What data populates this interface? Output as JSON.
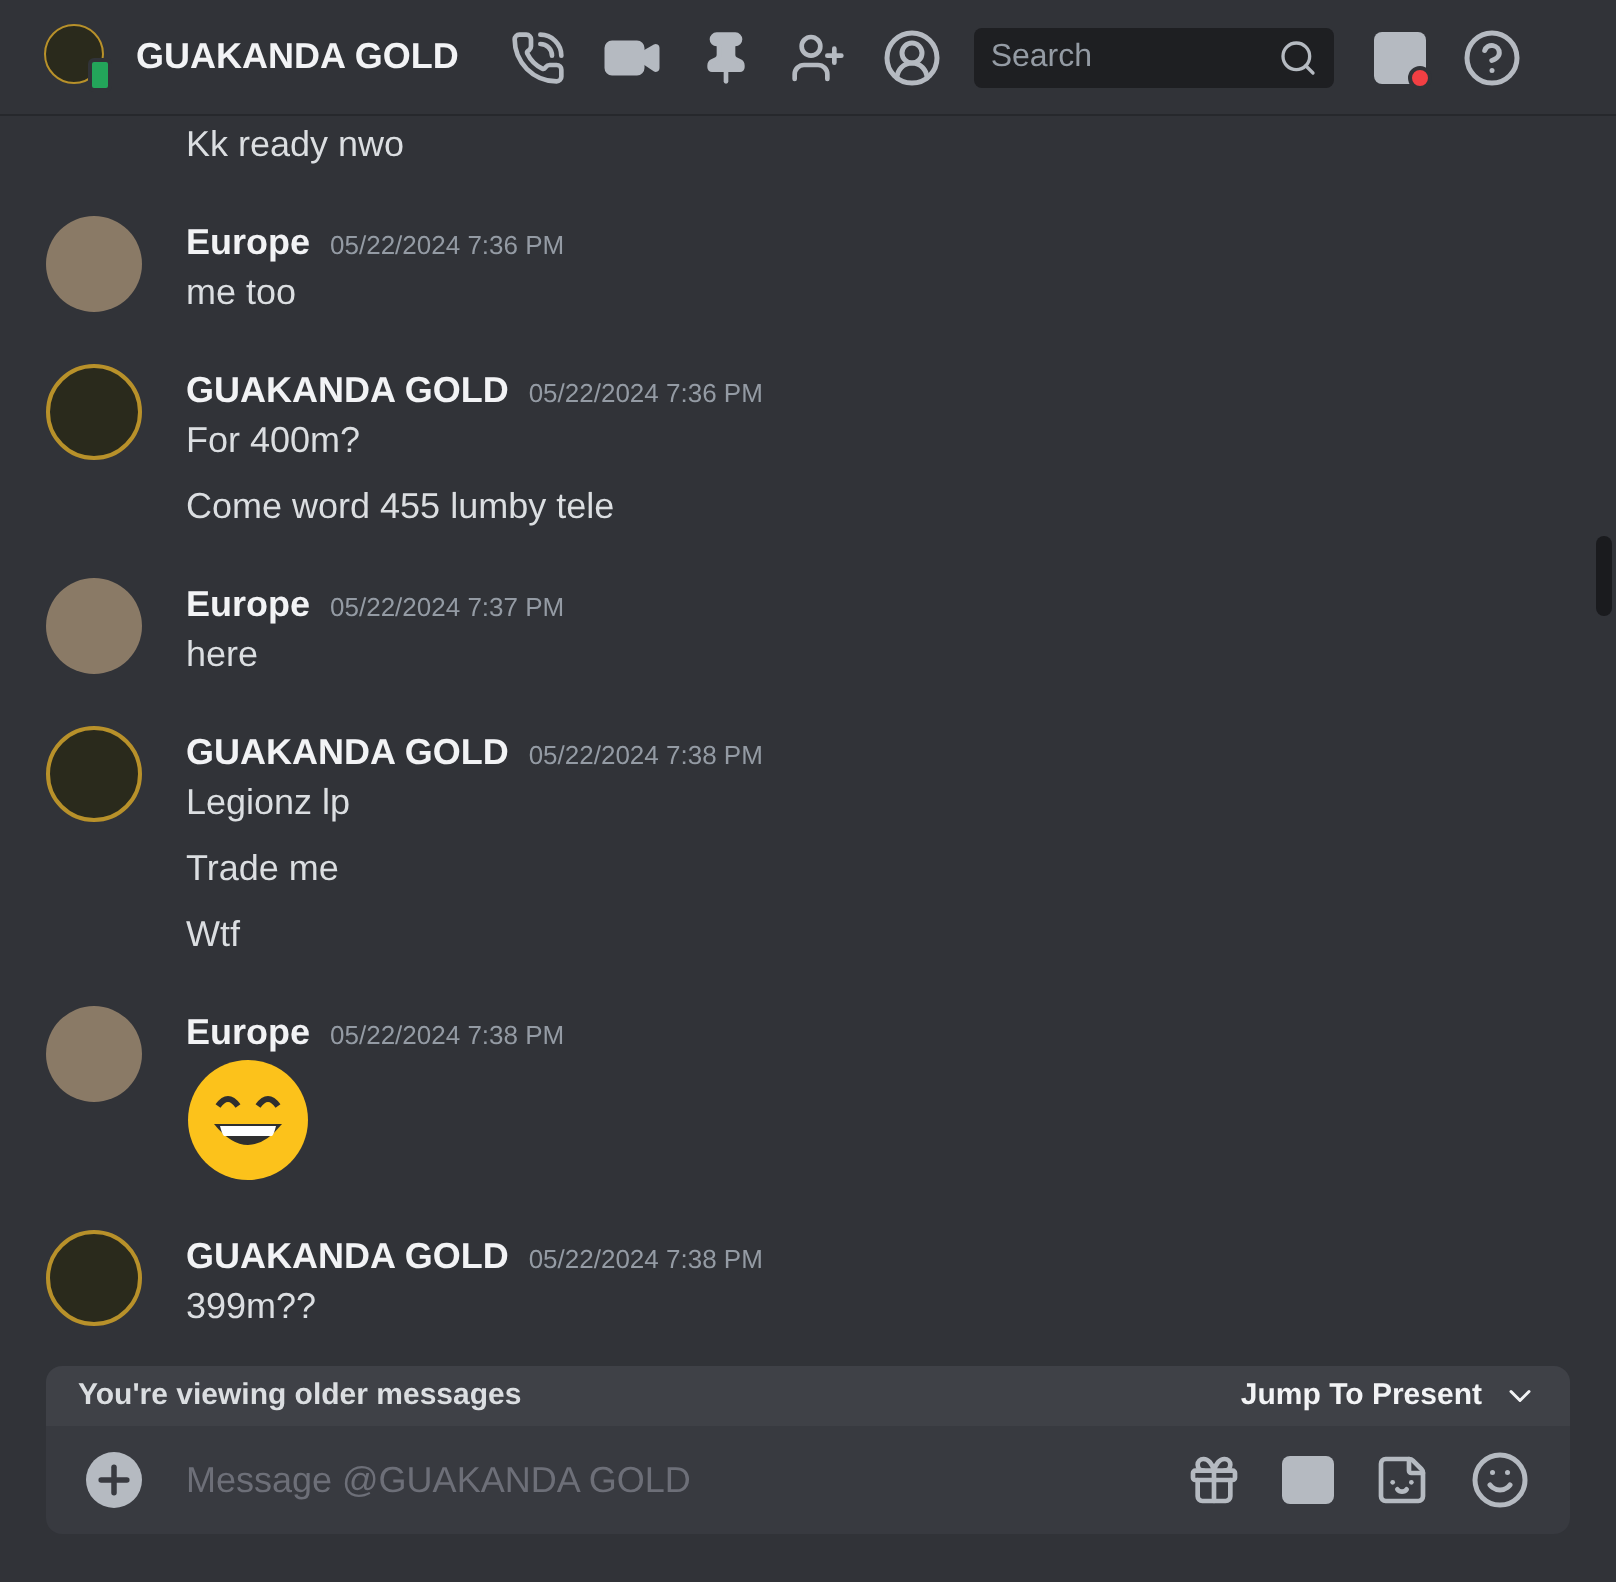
{
  "header": {
    "title": "GUAKANDA GOLD",
    "search": {
      "placeholder": "Search"
    }
  },
  "messages": [
    {
      "kind": "continuation",
      "lines": [
        {
          "kind": "text",
          "text": "Kk ready nwo"
        }
      ]
    },
    {
      "kind": "photo-avatar",
      "author": "Europe",
      "timestamp": "05/22/2024 7:36 PM",
      "lines": [
        {
          "kind": "text",
          "text": "me too"
        }
      ]
    },
    {
      "kind": "logo-avatar",
      "author": "GUAKANDA GOLD",
      "timestamp": "05/22/2024 7:36 PM",
      "lines": [
        {
          "kind": "text",
          "text": "For 400m?"
        },
        {
          "kind": "text",
          "text": "Come word 455 lumby tele"
        }
      ]
    },
    {
      "kind": "photo-avatar",
      "author": "Europe",
      "timestamp": "05/22/2024 7:37 PM",
      "lines": [
        {
          "kind": "text",
          "text": "here"
        }
      ]
    },
    {
      "kind": "logo-avatar",
      "author": "GUAKANDA GOLD",
      "timestamp": "05/22/2024 7:38 PM",
      "lines": [
        {
          "kind": "text",
          "text": "Legionz lp"
        },
        {
          "kind": "text",
          "text": "Trade me"
        },
        {
          "kind": "text",
          "text": "Wtf"
        }
      ]
    },
    {
      "kind": "photo-avatar",
      "author": "Europe",
      "timestamp": "05/22/2024 7:38 PM",
      "lines": [
        {
          "kind": "emoji"
        }
      ]
    },
    {
      "kind": "logo-avatar",
      "author": "GUAKANDA GOLD",
      "timestamp": "05/22/2024 7:38 PM",
      "lines": [
        {
          "kind": "text",
          "text": "399m??"
        }
      ]
    }
  ],
  "banner": {
    "text": "You're viewing older messages",
    "action": "Jump To Present"
  },
  "composer": {
    "placeholder": "Message @GUAKANDA GOLD"
  }
}
